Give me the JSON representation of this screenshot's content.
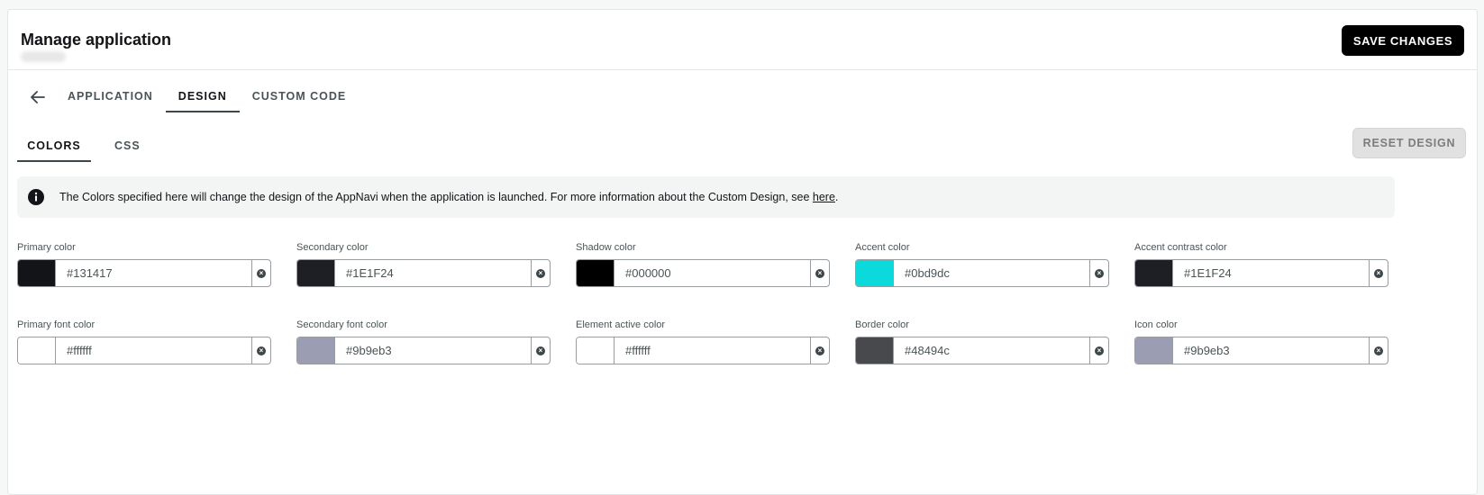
{
  "header": {
    "title": "Manage application",
    "save_label": "SAVE CHANGES"
  },
  "tabs": [
    {
      "label": "APPLICATION",
      "active": false
    },
    {
      "label": "DESIGN",
      "active": true
    },
    {
      "label": "CUSTOM CODE",
      "active": false
    }
  ],
  "subtabs": [
    {
      "label": "COLORS",
      "active": true
    },
    {
      "label": "CSS",
      "active": false
    }
  ],
  "reset_label": "RESET DESIGN",
  "info": {
    "text": "The Colors specified here will change the design of the AppNavi when the application is launched. For more information about the Custom Design, see ",
    "link": "here",
    "suffix": "."
  },
  "fields": [
    {
      "label": "Primary color",
      "value": "#131417",
      "swatch": "#131417"
    },
    {
      "label": "Secondary color",
      "value": "#1E1F24",
      "swatch": "#1E1F24"
    },
    {
      "label": "Shadow color",
      "value": "#000000",
      "swatch": "#000000"
    },
    {
      "label": "Accent color",
      "value": "#0bd9dc",
      "swatch": "#0bd9dc"
    },
    {
      "label": "Accent contrast color",
      "value": "#1E1F24",
      "swatch": "#1E1F24"
    },
    {
      "label": "Primary font color",
      "value": "#ffffff",
      "swatch": "#ffffff"
    },
    {
      "label": "Secondary font color",
      "value": "#9b9eb3",
      "swatch": "#9b9eb3"
    },
    {
      "label": "Element active color",
      "value": "#ffffff",
      "swatch": "#ffffff"
    },
    {
      "label": "Border color",
      "value": "#48494c",
      "swatch": "#48494c"
    },
    {
      "label": "Icon color",
      "value": "#9b9eb3",
      "swatch": "#9b9eb3"
    }
  ]
}
